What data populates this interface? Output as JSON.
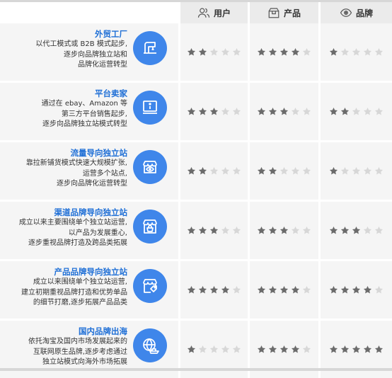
{
  "header": {
    "user_label": "用户",
    "product_label": "产品",
    "brand_label": "品牌"
  },
  "rows": [
    {
      "title": "外贸工厂",
      "lines": [
        "以代工模式或 B2B 模式起步,",
        "逐步向品牌独立站和",
        "品牌化运营转型"
      ],
      "icon": "sewing-machine-icon",
      "ratings": {
        "user": 2,
        "product": 4,
        "brand": 1
      }
    },
    {
      "title": "平台卖家",
      "lines": [
        "通过在 ebay、Amazon 等",
        "第三方平台销售起步,",
        "逐步向品牌独立站模式转型"
      ],
      "icon": "info-monitor-icon",
      "ratings": {
        "user": 3,
        "product": 3,
        "brand": 2
      }
    },
    {
      "title": "流量导向独立站",
      "lines": [
        "靠拉新铺货模式快速大规模扩张,",
        "运营多个站点,",
        "逐步向品牌化运营转型"
      ],
      "icon": "storefront-eye-icon",
      "ratings": {
        "user": 2,
        "product": 2,
        "brand": 1
      }
    },
    {
      "title": "渠道品牌导向独立站",
      "lines": [
        "成立以来主要围绕单个独立站运营,",
        "以产品为发展重心,",
        "逐步重视品牌打造及跨品类拓展"
      ],
      "icon": "shop-basket-icon",
      "ratings": {
        "user": 3,
        "product": 3,
        "brand": 3
      }
    },
    {
      "title": "产品品牌导向独立站",
      "lines": [
        "成立以来围绕单个独立站运营,",
        "建立初期重视品牌打造和优势单品",
        "的细节打磨,逐步拓展产品品类"
      ],
      "icon": "shop-tag-icon",
      "ratings": {
        "user": 4,
        "product": 4,
        "brand": 4
      }
    },
    {
      "title": "国内品牌出海",
      "lines": [
        "依托淘宝及国内市场发展起来的",
        "互联网原生品牌,逐步考虑通过",
        "独立站模式向海外市场拓展"
      ],
      "icon": "globe-ship-icon",
      "ratings": {
        "user": 1,
        "product": 4,
        "brand": 5
      }
    }
  ],
  "colors": {
    "accent": "#3f86ea",
    "title": "#1f6fd6",
    "star_on": "#6b6b6b",
    "star_off": "#d7d7d7",
    "row_bg": "#f5f5f5",
    "header_bg": "#ebebeb"
  }
}
